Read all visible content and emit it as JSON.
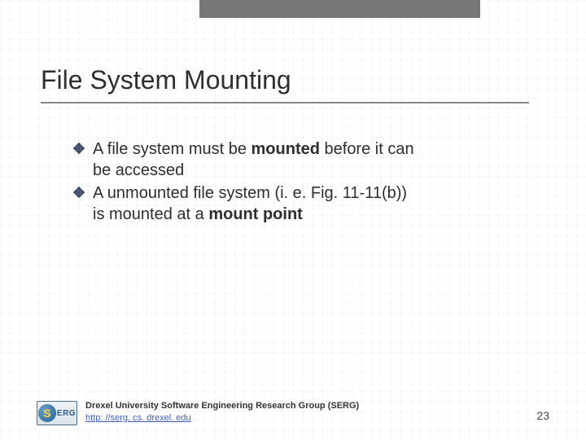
{
  "title": "File System Mounting",
  "bullets": [
    {
      "pre": "A file system must be ",
      "bold": "mounted",
      "post": " before it can be accessed"
    },
    {
      "pre": "A unmounted file system (i. e. Fig. 11-11(b)) is mounted at a ",
      "bold": "mount point",
      "post": ""
    }
  ],
  "footer": {
    "org": "Drexel University Software Engineering Research Group (SERG)",
    "link_scheme": "http: //",
    "link_host": "serg. cs. drexel. edu"
  },
  "logo": {
    "s": "S",
    "erg": "ERG"
  },
  "page": "23"
}
